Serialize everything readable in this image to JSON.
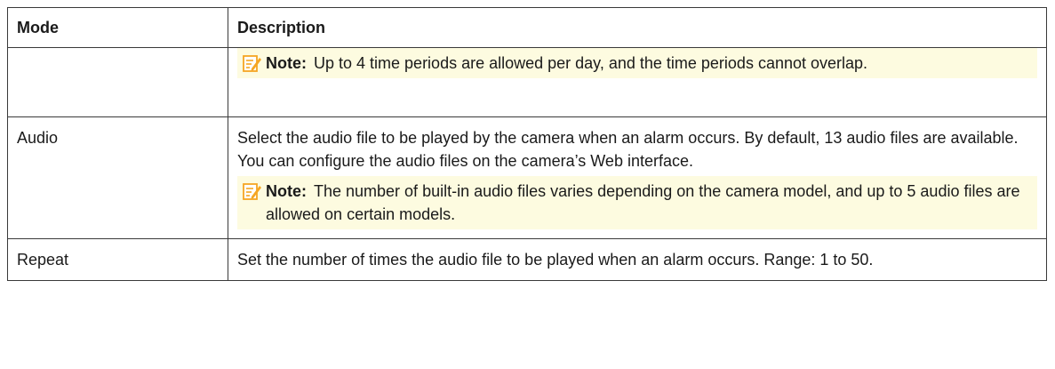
{
  "table": {
    "headers": {
      "mode": "Mode",
      "description": "Description"
    },
    "rows": [
      {
        "mode": "",
        "description": "",
        "note": {
          "label": "Note:",
          "text": "Up to 4 time periods are allowed per day, and the time periods cannot overlap."
        }
      },
      {
        "mode": "Audio",
        "description": "Select the audio file to be played by the camera when an alarm occurs. By default, 13 audio files are available. You can configure the audio files on the camera’s Web interface.",
        "note": {
          "label": "Note:",
          "text": "The number of built-in audio files varies depending on the camera model, and up to 5 audio files are allowed on certain models."
        }
      },
      {
        "mode": "Repeat",
        "description": "Set the number of times the audio file to be played when an alarm occurs. Range: 1 to 50.",
        "note": null
      }
    ]
  },
  "icons": {
    "note": "note-pencil-icon",
    "note_color": "#f5a623",
    "note_bg": "#fdfbe0"
  }
}
